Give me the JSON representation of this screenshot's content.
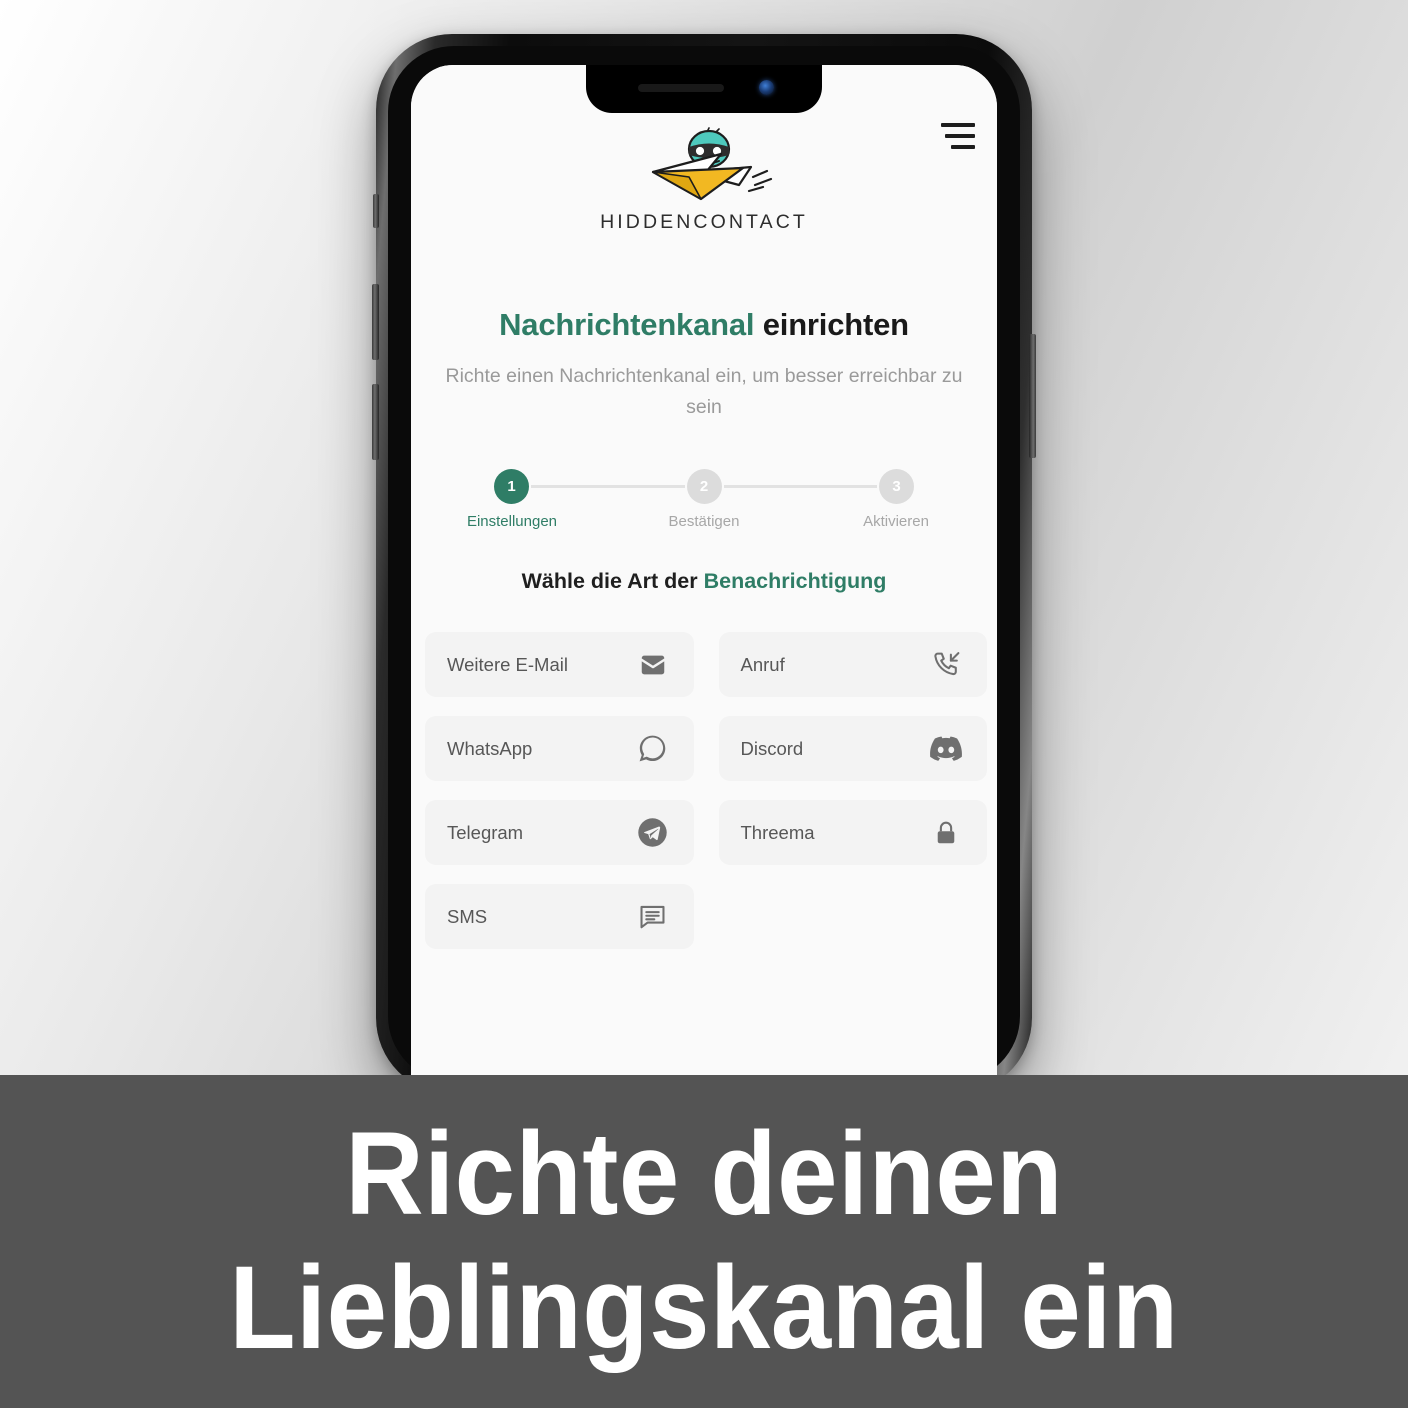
{
  "brand": {
    "name": "HIDDENCONTACT",
    "logo_icon": "ninja-paper-plane-logo",
    "colors": {
      "accent_green": "#2f7d66",
      "logo_teal": "#4ec9bd",
      "logo_yellow": "#f2b822",
      "caption_bg": "#545454",
      "button_bg": "#f3f3f3",
      "muted_text": "#9a9a9a"
    }
  },
  "header": {
    "menu_icon": "hamburger-menu-icon"
  },
  "page": {
    "title_accent": "Nachrichtenkanal",
    "title_rest": " einrichten",
    "subtitle": "Richte einen Nachrichtenkanal ein, um besser erreichbar zu sein"
  },
  "stepper": {
    "steps": [
      {
        "number": "1",
        "label": "Einstellungen",
        "state": "active"
      },
      {
        "number": "2",
        "label": "Bestätigen",
        "state": "inactive"
      },
      {
        "number": "3",
        "label": "Aktivieren",
        "state": "inactive"
      }
    ]
  },
  "section": {
    "heading_prefix": "Wähle die Art der ",
    "heading_accent": "Benachrichtigung"
  },
  "options": [
    {
      "label": "Weitere E-Mail",
      "icon": "envelope-icon"
    },
    {
      "label": "Anruf",
      "icon": "incoming-call-icon"
    },
    {
      "label": "WhatsApp",
      "icon": "whatsapp-icon"
    },
    {
      "label": "Discord",
      "icon": "discord-icon"
    },
    {
      "label": "Telegram",
      "icon": "telegram-icon"
    },
    {
      "label": "Threema",
      "icon": "lock-icon"
    },
    {
      "label": "SMS",
      "icon": "chat-bubble-icon"
    }
  ],
  "caption": {
    "line1": "Richte deinen",
    "line2": "Lieblingskanal ein"
  }
}
